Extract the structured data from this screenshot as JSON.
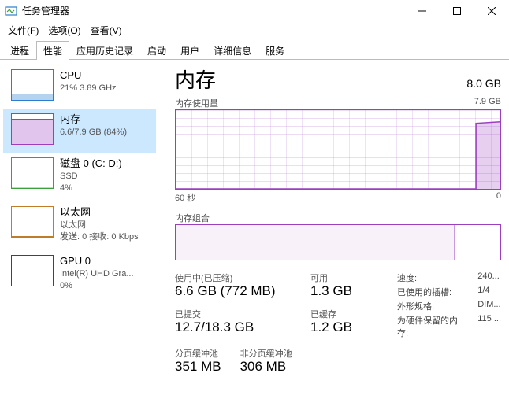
{
  "title": "任务管理器",
  "menus": {
    "file": "文件(F)",
    "options": "选项(O)",
    "view": "查看(V)"
  },
  "tabs": {
    "processes": "进程",
    "performance": "性能",
    "app_history": "应用历史记录",
    "startup": "启动",
    "users": "用户",
    "details": "详细信息",
    "services": "服务"
  },
  "sidebar": {
    "cpu": {
      "name": "CPU",
      "sub": "21%  3.89 GHz"
    },
    "memory": {
      "name": "内存",
      "sub": "6.6/7.9 GB (84%)"
    },
    "disk": {
      "name": "磁盘 0 (C: D:)",
      "sub1": "SSD",
      "sub2": "4%"
    },
    "eth": {
      "name": "以太网",
      "sub1": "以太网",
      "sub2": "发送: 0 接收: 0 Kbps"
    },
    "gpu": {
      "name": "GPU 0",
      "sub1": "Intel(R) UHD Gra...",
      "sub2": "0%"
    }
  },
  "main": {
    "heading": "内存",
    "total": "8.0 GB",
    "chart1_label": "内存使用量",
    "chart1_max": "7.9 GB",
    "chart1_axis_left": "60 秒",
    "chart1_axis_right": "0",
    "chart2_label": "内存组合"
  },
  "stats": {
    "in_use_label": "使用中(已压缩)",
    "in_use_value": "6.6 GB (772 MB)",
    "avail_label": "可用",
    "avail_value": "1.3 GB",
    "committed_label": "已提交",
    "committed_value": "12.7/18.3 GB",
    "cached_label": "已缓存",
    "cached_value": "1.2 GB",
    "paged_label": "分页缓冲池",
    "paged_value": "351 MB",
    "nonpaged_label": "非分页缓冲池",
    "nonpaged_value": "306 MB"
  },
  "details": {
    "speed_label": "速度:",
    "speed_value": "240...",
    "slots_label": "已使用的插槽:",
    "slots_value": "1/4",
    "form_label": "外形规格:",
    "form_value": "DIM...",
    "hw_label": "为硬件保留的内存:",
    "hw_value": "115 ..."
  },
  "chart_data": {
    "type": "area",
    "title": "内存使用量",
    "ylabel": "GB",
    "ylim": [
      0,
      7.9
    ],
    "x_seconds": [
      60,
      55,
      50,
      45,
      40,
      35,
      30,
      25,
      20,
      15,
      10,
      5,
      0
    ],
    "values": [
      0,
      0,
      0,
      0,
      0,
      0,
      0,
      0,
      0,
      0,
      0,
      6.6,
      6.6
    ]
  }
}
